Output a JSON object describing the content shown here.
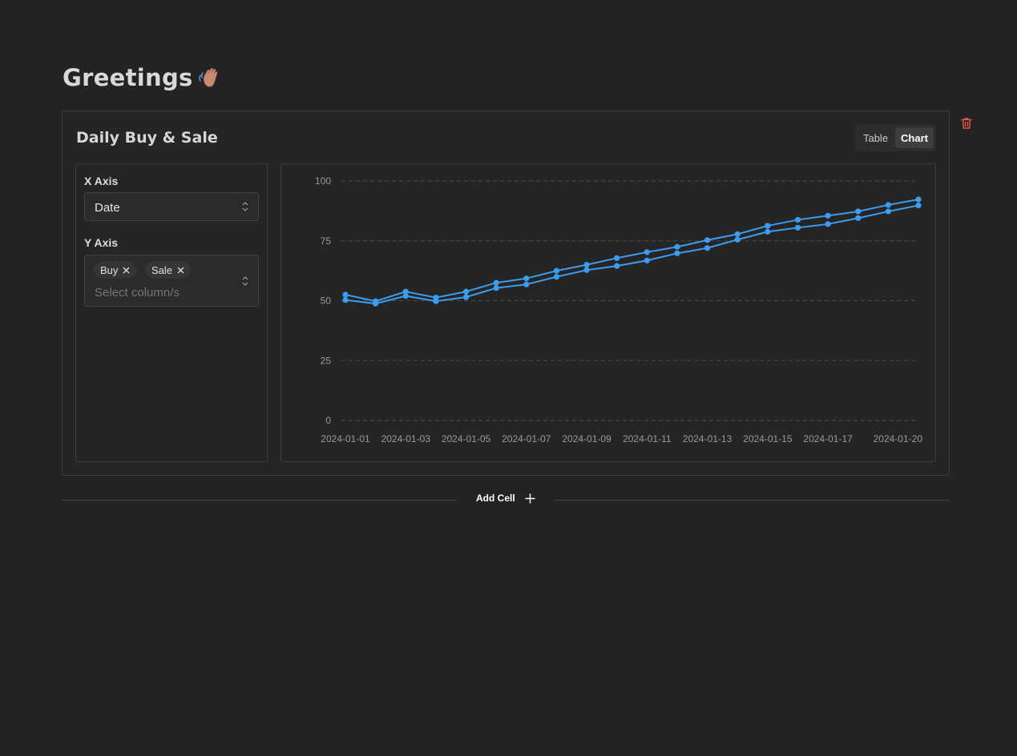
{
  "page": {
    "title": "Greetings"
  },
  "cell": {
    "title": "Daily Buy & Sale",
    "view_toggle": {
      "options": [
        "Table",
        "Chart"
      ],
      "selected": "Chart"
    }
  },
  "config": {
    "x_axis": {
      "label": "X Axis",
      "value": "Date"
    },
    "y_axis": {
      "label": "Y Axis",
      "chips": [
        "Buy",
        "Sale"
      ],
      "placeholder": "Select column/s"
    }
  },
  "add_cell": {
    "label": "Add Cell"
  },
  "icons": {
    "title_emoji": "waving-hand-icon",
    "delete": "trash-icon",
    "chip_remove": "close-icon",
    "select": "chevron-updown-icon",
    "add": "plus-icon"
  },
  "colors": {
    "series": "#3b9cf0",
    "delete": "#e0574f"
  },
  "chart_data": {
    "type": "line",
    "x": [
      "2024-01-01",
      "2024-01-02",
      "2024-01-03",
      "2024-01-04",
      "2024-01-05",
      "2024-01-06",
      "2024-01-07",
      "2024-01-08",
      "2024-01-09",
      "2024-01-10",
      "2024-01-11",
      "2024-01-12",
      "2024-01-13",
      "2024-01-14",
      "2024-01-15",
      "2024-01-16",
      "2024-01-17",
      "2024-01-18",
      "2024-01-19",
      "2024-01-20"
    ],
    "x_tick_labels": [
      "2024-01-01",
      "2024-01-03",
      "2024-01-05",
      "2024-01-07",
      "2024-01-09",
      "2024-01-11",
      "2024-01-13",
      "2024-01-15",
      "2024-01-17",
      "2024-01-20"
    ],
    "series": [
      {
        "name": "Buy",
        "values": [
          52.5,
          49.8,
          53.8,
          51.3,
          53.8,
          57.5,
          59.3,
          62.5,
          65.0,
          67.8,
          70.3,
          72.5,
          75.3,
          77.8,
          81.3,
          83.8,
          85.5,
          87.3,
          90.0,
          92.3
        ]
      },
      {
        "name": "Sale",
        "values": [
          50.3,
          48.8,
          52.0,
          49.8,
          51.5,
          55.3,
          56.8,
          60.0,
          62.8,
          64.5,
          66.8,
          69.8,
          72.0,
          75.5,
          78.8,
          80.5,
          82.0,
          84.5,
          87.3,
          89.8
        ]
      }
    ],
    "ylim": [
      0,
      100
    ],
    "y_ticks": [
      0,
      25,
      50,
      75,
      100
    ],
    "grid": "horizontal-dashed",
    "legend": "none"
  }
}
